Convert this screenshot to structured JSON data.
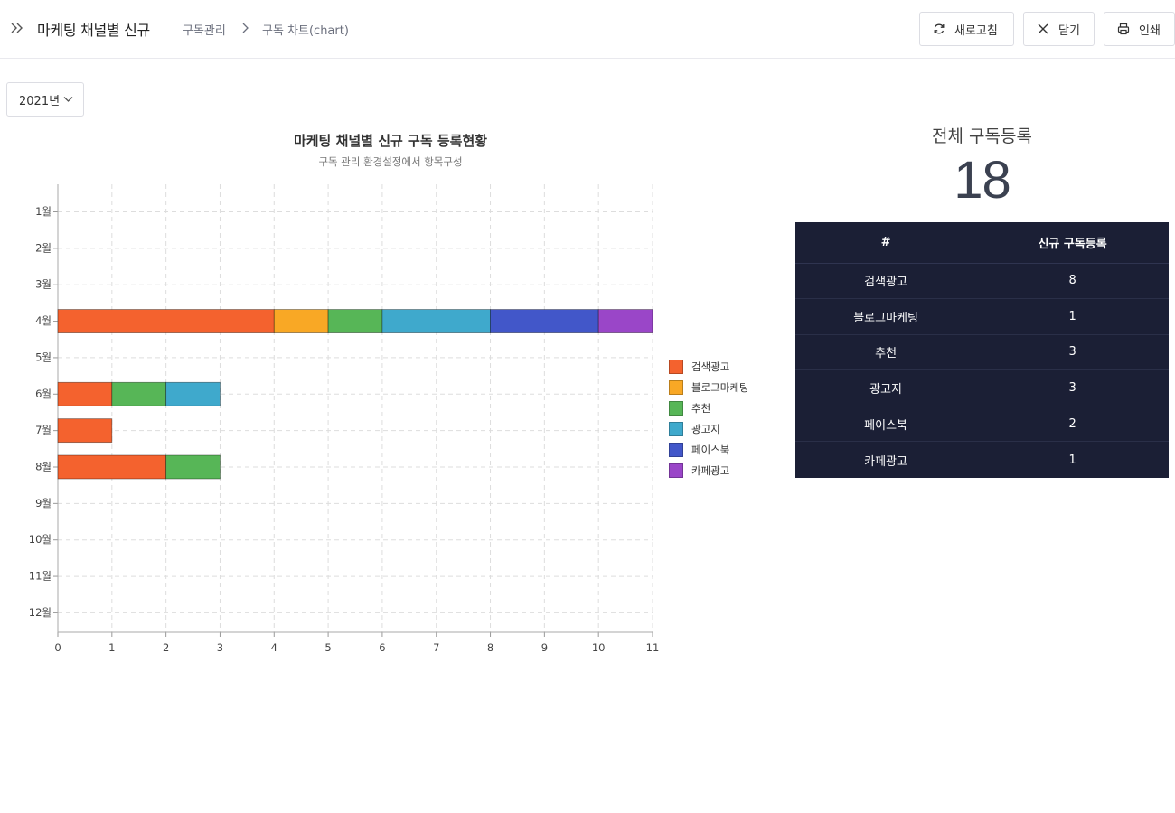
{
  "header": {
    "title": "마케팅 채널별 신규",
    "breadcrumb": [
      "구독관리",
      "구독 차트(chart)"
    ],
    "buttons": {
      "refresh": "새로고침",
      "close": "닫기",
      "print": "인쇄"
    }
  },
  "filter": {
    "year": "2021년"
  },
  "chart_data": {
    "type": "bar",
    "orientation": "horizontal",
    "stacked": true,
    "title": "마케팅 채널별 신규 구독 등록현황",
    "subtitle": "구독 관리 환경설정에서 항목구성",
    "categories": [
      "1월",
      "2월",
      "3월",
      "4월",
      "5월",
      "6월",
      "7월",
      "8월",
      "9월",
      "10월",
      "11월",
      "12월"
    ],
    "series": [
      {
        "name": "검색광고",
        "color": "#f4622e",
        "values": [
          0,
          0,
          0,
          4,
          0,
          1,
          1,
          2,
          0,
          0,
          0,
          0
        ]
      },
      {
        "name": "블로그마케팅",
        "color": "#f9a825",
        "values": [
          0,
          0,
          0,
          1,
          0,
          0,
          0,
          0,
          0,
          0,
          0,
          0
        ]
      },
      {
        "name": "추천",
        "color": "#57b657",
        "values": [
          0,
          0,
          0,
          1,
          0,
          1,
          0,
          1,
          0,
          0,
          0,
          0
        ]
      },
      {
        "name": "광고지",
        "color": "#3fa9cc",
        "values": [
          0,
          0,
          0,
          2,
          0,
          1,
          0,
          0,
          0,
          0,
          0,
          0
        ]
      },
      {
        "name": "페이스북",
        "color": "#4257c9",
        "values": [
          0,
          0,
          0,
          2,
          0,
          0,
          0,
          0,
          0,
          0,
          0,
          0
        ]
      },
      {
        "name": "카페광고",
        "color": "#9a46c8",
        "values": [
          0,
          0,
          0,
          1,
          0,
          0,
          0,
          0,
          0,
          0,
          0,
          0
        ]
      }
    ],
    "xlim": [
      0,
      11
    ],
    "xticks": [
      "0",
      "1",
      "2",
      "3",
      "4",
      "5",
      "6",
      "7",
      "8",
      "9",
      "10",
      "11"
    ],
    "grid": true,
    "legend": "right"
  },
  "summary": {
    "total_label": "전체 구독등록",
    "total_value": "18",
    "columns": [
      "#",
      "신규 구독등록"
    ],
    "rows": [
      [
        "검색광고",
        "8"
      ],
      [
        "블로그마케팅",
        "1"
      ],
      [
        "추천",
        "3"
      ],
      [
        "광고지",
        "3"
      ],
      [
        "페이스북",
        "2"
      ],
      [
        "카페광고",
        "1"
      ]
    ]
  }
}
